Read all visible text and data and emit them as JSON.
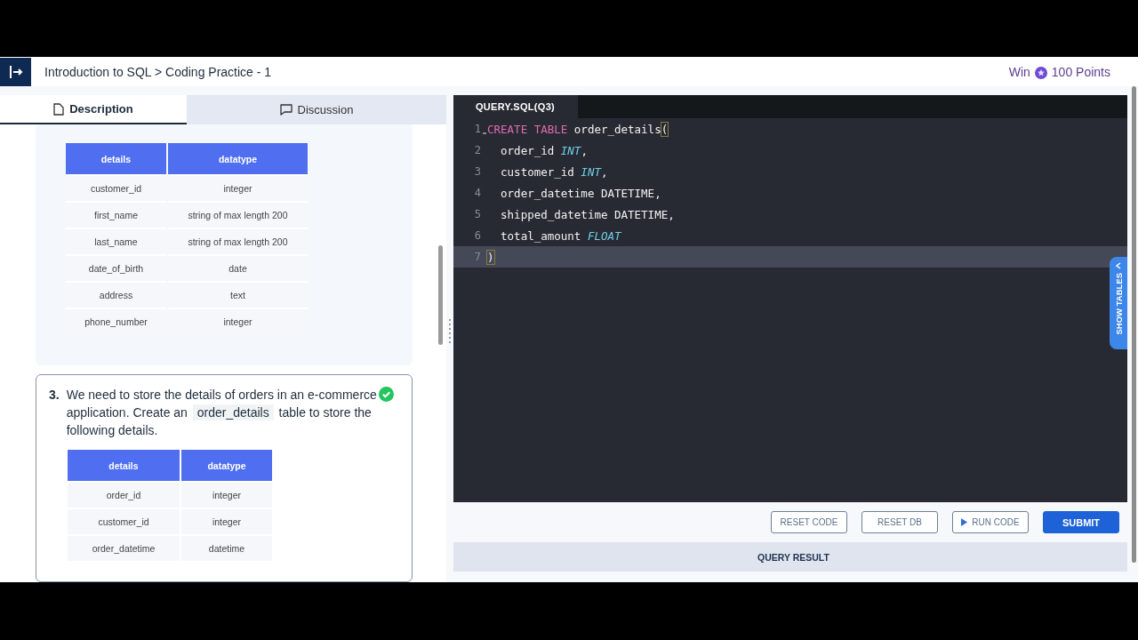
{
  "header": {
    "breadcrumb": "Introduction to SQL > Coding Practice - 1",
    "reward_prefix": "Win",
    "reward_points": "100 Points"
  },
  "tabs": [
    {
      "label": "Description",
      "selected": true,
      "kind": "document"
    },
    {
      "label": "Discussion",
      "selected": false,
      "kind": "chat"
    }
  ],
  "questions": [
    {
      "completed": false,
      "table": {
        "columns": [
          "details",
          "datatype"
        ],
        "rows": [
          [
            "customer_id",
            "integer"
          ],
          [
            "first_name",
            "string of max length 200"
          ],
          [
            "last_name",
            "string of max length 200"
          ],
          [
            "date_of_birth",
            "date"
          ],
          [
            "address",
            "text"
          ],
          [
            "phone_number",
            "integer"
          ]
        ]
      }
    },
    {
      "number": "3.",
      "completed": true,
      "text_before": "We need to store the details of orders in an e-commerce application. Create an",
      "code": "order_details",
      "text_after": "table to store the following details.",
      "table": {
        "columns": [
          "details",
          "datatype"
        ],
        "rows": [
          [
            "order_id",
            "integer"
          ],
          [
            "customer_id",
            "integer"
          ],
          [
            "order_datetime",
            "datetime"
          ]
        ]
      }
    }
  ],
  "editor": {
    "file_tab": "QUERY.SQL(Q3)",
    "lines": [
      {
        "number": "1",
        "current": false,
        "fold": true,
        "tokens": [
          {
            "text": "CREATE TABLE",
            "kind": "keyword"
          },
          {
            "text": " order_details",
            "kind": "plain"
          },
          {
            "text": "(",
            "kind": "bracket"
          }
        ]
      },
      {
        "number": "2",
        "current": false,
        "fold": false,
        "tokens": [
          {
            "text": "  order_id ",
            "kind": "plain"
          },
          {
            "text": "INT",
            "kind": "type"
          },
          {
            "text": ",",
            "kind": "plain"
          }
        ]
      },
      {
        "number": "3",
        "current": false,
        "fold": false,
        "tokens": [
          {
            "text": "  customer_id ",
            "kind": "plain"
          },
          {
            "text": "INT",
            "kind": "type"
          },
          {
            "text": ",",
            "kind": "plain"
          }
        ]
      },
      {
        "number": "4",
        "current": false,
        "fold": false,
        "tokens": [
          {
            "text": "  order_datetime DATETIME,",
            "kind": "plain"
          }
        ]
      },
      {
        "number": "5",
        "current": false,
        "fold": false,
        "tokens": [
          {
            "text": "  shipped_datetime DATETIME,",
            "kind": "plain"
          }
        ]
      },
      {
        "number": "6",
        "current": false,
        "fold": false,
        "tokens": [
          {
            "text": "  total_amount ",
            "kind": "plain"
          },
          {
            "text": "FLOAT",
            "kind": "type"
          }
        ]
      },
      {
        "number": "7",
        "current": true,
        "fold": false,
        "tokens": [
          {
            "text": ")",
            "kind": "bracket"
          }
        ]
      }
    ]
  },
  "side_tab": "SHOW TABLES",
  "buttons": [
    {
      "label": "RESET CODE",
      "kind": "outline"
    },
    {
      "label": "RESET DB",
      "kind": "outline"
    },
    {
      "label": "RUN CODE",
      "kind": "run"
    },
    {
      "label": "SUBMIT",
      "kind": "primary"
    }
  ],
  "result_bar": "QUERY RESULT"
}
